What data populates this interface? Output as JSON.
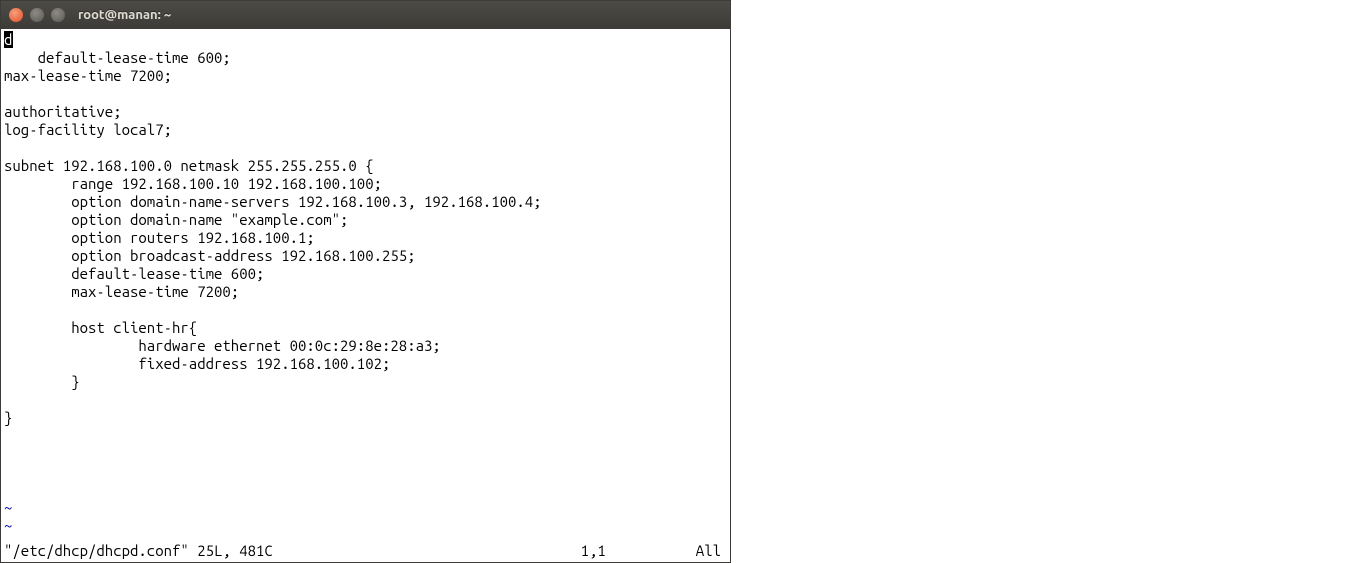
{
  "window": {
    "title": "root@manan: ~"
  },
  "editor": {
    "lines": [
      "default-lease-time 600;",
      "max-lease-time 7200;",
      "",
      "authoritative;",
      "log-facility local7;",
      "",
      "subnet 192.168.100.0 netmask 255.255.255.0 {",
      "        range 192.168.100.10 192.168.100.100;",
      "        option domain-name-servers 192.168.100.3, 192.168.100.4;",
      "        option domain-name \"example.com\";",
      "        option routers 192.168.100.1;",
      "        option broadcast-address 192.168.100.255;",
      "        default-lease-time 600;",
      "        max-lease-time 7200;",
      "",
      "        host client-hr{",
      "                hardware ethernet 00:0c:29:8e:28:a3;",
      "                fixed-address 192.168.100.102;",
      "        }",
      "",
      "}",
      "",
      "",
      "",
      ""
    ],
    "tilde_lines": [
      "~",
      "~",
      "~"
    ],
    "cursor_char": "d"
  },
  "status": {
    "file_info": "\"/etc/dhcp/dhcpd.conf\" 25L, 481C",
    "position": "1,1",
    "scroll": "All"
  }
}
